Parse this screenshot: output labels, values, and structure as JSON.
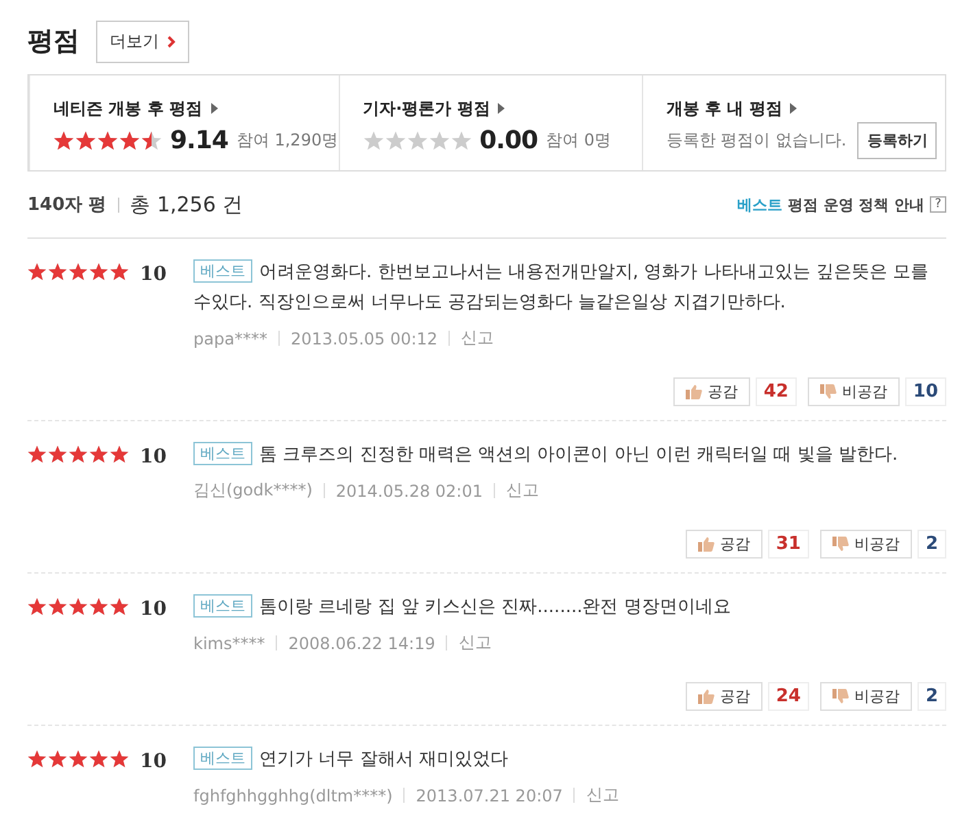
{
  "header": {
    "title": "평점",
    "more_button": "더보기"
  },
  "summary": [
    {
      "kind": "score",
      "title": "네티즌 개봉 후 평점",
      "stars": 4.5,
      "score": "9.14",
      "participants": "참여 1,290명"
    },
    {
      "kind": "score",
      "title": "기자·평론가 평점",
      "stars": 0,
      "score": "0.00",
      "participants": "참여 0명"
    },
    {
      "kind": "mine",
      "title": "개봉 후 내 평점",
      "message": "등록한 평점이 없습니다.",
      "button": "등록하기"
    }
  ],
  "list_header": {
    "type": "140자 평",
    "total": "총 1,256 건",
    "policy_highlight": "베스트",
    "policy": "평점 운영 정책 안내",
    "help": "?"
  },
  "reviews": [
    {
      "stars": 5,
      "score": "10",
      "badge": "베스트",
      "text": "어려운영화다. 한번보고나서는 내용전개만알지, 영화가 나타내고있는 깊은뜻은 모를수있다. 직장인으로써 너무나도 공감되는영화다 늘같은일상 지겹기만하다.",
      "author": "papa****",
      "date": "2013.05.05 00:12",
      "report": "신고",
      "like_label": "공감",
      "likes": "42",
      "dislike_label": "비공감",
      "dislikes": "10"
    },
    {
      "stars": 5,
      "score": "10",
      "badge": "베스트",
      "text": "톰 크루즈의 진정한 매력은 액션의 아이콘이 아닌 이런 캐릭터일 때 빛을 발한다.",
      "author": "김신(godk****)",
      "date": "2014.05.28 02:01",
      "report": "신고",
      "like_label": "공감",
      "likes": "31",
      "dislike_label": "비공감",
      "dislikes": "2"
    },
    {
      "stars": 5,
      "score": "10",
      "badge": "베스트",
      "text": "톰이랑 르네랑 집 앞 키스신은 진짜........완전 명장면이네요",
      "author": "kims****",
      "date": "2008.06.22 14:19",
      "report": "신고",
      "like_label": "공감",
      "likes": "24",
      "dislike_label": "비공감",
      "dislikes": "2"
    },
    {
      "stars": 5,
      "score": "10",
      "badge": "베스트",
      "text": "연기가 너무 잘해서 재미있었다",
      "author": "fghfghhgghhg(dltm****)",
      "date": "2013.07.21 20:07",
      "report": "신고"
    }
  ]
}
